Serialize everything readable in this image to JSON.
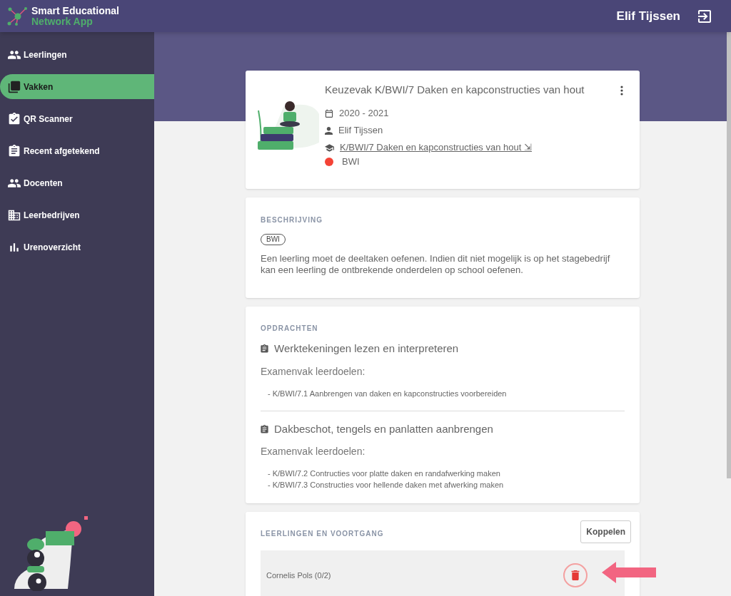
{
  "app": {
    "logo_line_1": "Smart Educational",
    "logo_line_2": "Network App",
    "user_name": "Elif Tijssen"
  },
  "sidebar": {
    "items": [
      {
        "label": "Leerlingen",
        "selected": false
      },
      {
        "label": "Vakken",
        "selected": true
      },
      {
        "label": "QR Scanner",
        "selected": false
      },
      {
        "label": "Recent afgetekend",
        "selected": false
      },
      {
        "label": "Docenten",
        "selected": false
      },
      {
        "label": "Leerbedrijven",
        "selected": false
      },
      {
        "label": "Urenoverzicht",
        "selected": false
      }
    ]
  },
  "course_card": {
    "title": "Keuzevak K/BWI/7 Daken en kapconstructies van hout",
    "school_year": "2020 - 2021",
    "teacher": "Elif Tijssen",
    "link": "K/BWI/7 Daken en kapconstructies van hout ⇲",
    "tag": {
      "label": "BWI",
      "color": "#f44336"
    }
  },
  "description": {
    "heading": "BESCHRIJVING",
    "chip": "BWI",
    "text": "Een leerling moet de deeltaken oefenen. Indien dit niet mogelijk is op het stagebedrijf kan een leerling de ontbrekende onderdelen op school oefenen."
  },
  "assignments": {
    "heading": "OPDRACHTEN",
    "items": [
      {
        "title": "Werktekeningen lezen en interpreteren",
        "goals_label": "Examenvak leerdoelen:",
        "goals": [
          "- K/BWI/7.1 Aanbrengen van daken en kapconstructies voorbereiden"
        ]
      },
      {
        "title": "Dakbeschot, tengels en panlatten aanbrengen",
        "goals_label": "Examenvak leerdoelen:",
        "goals": [
          "- K/BWI/7.2 Contructies voor platte daken en randafwerking maken",
          "- K/BWI/7.3 Constructies voor hellende daken met afwerking maken"
        ]
      }
    ]
  },
  "students": {
    "heading": "LEERLINGEN EN VOORTGANG",
    "button": "Koppelen",
    "rows": [
      {
        "name": "Cornelis Pols (0/2)"
      }
    ]
  }
}
